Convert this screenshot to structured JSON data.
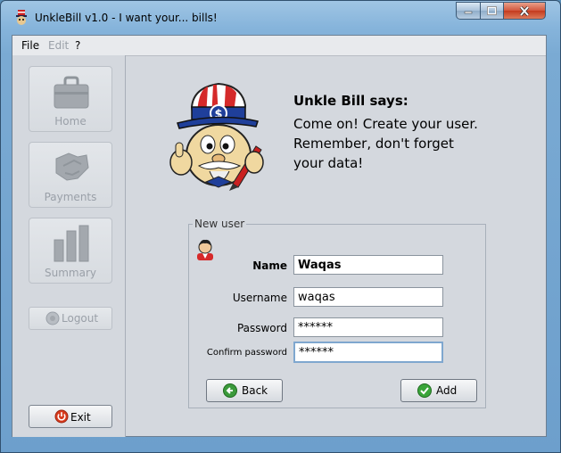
{
  "window": {
    "title": "UnkleBill v1.0 - I want your... bills!"
  },
  "menu": {
    "file": "File",
    "edit": "Edit",
    "help": "?"
  },
  "sidebar": {
    "home": "Home",
    "payments": "Payments",
    "summary": "Summary",
    "logout": "Logout",
    "exit": "Exit"
  },
  "message": {
    "title": "Unkle Bill says:",
    "line1": "Come on! Create your user.",
    "line2": "Remember, don't forget",
    "line3": "your data!"
  },
  "form": {
    "legend": "New user",
    "name_label": "Name",
    "name_value": "Waqas",
    "username_label": "Username",
    "username_value": "waqas",
    "password_label": "Password",
    "password_value": "******",
    "confirm_label": "Confirm password",
    "confirm_value": "******",
    "back": "Back",
    "add": "Add"
  },
  "icons": {
    "window_minimize": "minimize-icon",
    "window_maximize": "maximize-icon",
    "window_close": "close-icon",
    "home": "briefcase-icon",
    "payments": "handshake-icon",
    "summary": "bar-chart-icon",
    "logout": "logout-icon",
    "exit": "power-icon",
    "back": "back-arrow-icon",
    "add": "checkmark-icon",
    "user": "user-icon"
  },
  "colors": {
    "titlebar": "#86b4db",
    "close": "#c43b1e",
    "exit_icon": "#d83a1c",
    "back_icon": "#3b9a3b",
    "add_icon": "#3aa53a"
  }
}
